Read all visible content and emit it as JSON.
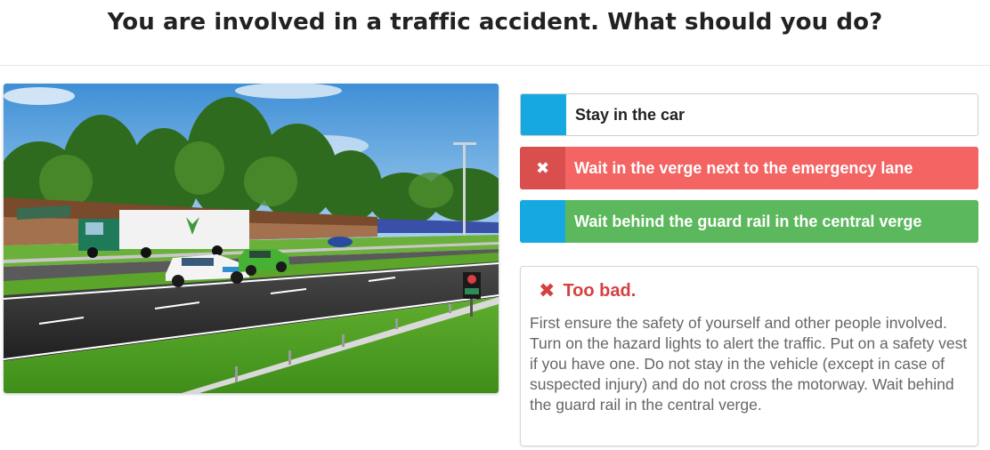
{
  "question": "You are involved in a traffic accident. What should you do?",
  "scene": {
    "image_alt": "Motorway with white car and green car stopped after a collision, truck in background"
  },
  "answers": [
    {
      "label": "Stay in the car",
      "marker": "",
      "state": "neutral"
    },
    {
      "label": "Wait in the verge next to the emergency lane",
      "marker": "✖",
      "state": "wrong"
    },
    {
      "label": "Wait behind the guard rail in the central verge",
      "marker": "",
      "state": "correct"
    }
  ],
  "feedback": {
    "icon": "✖",
    "title": "Too bad.",
    "text": "First ensure the safety of yourself and other people involved. Turn on the hazard lights to alert the traffic. Put on a safety vest if you have one. Do not stay in the vehicle (except in case of suspected injury) and do not cross the motorway. Wait behind the guard rail in the central verge."
  },
  "colors": {
    "accent_blue": "#16a9e1",
    "wrong_red": "#f36463",
    "correct_green": "#5cb85c",
    "feedback_red": "#d64040"
  }
}
